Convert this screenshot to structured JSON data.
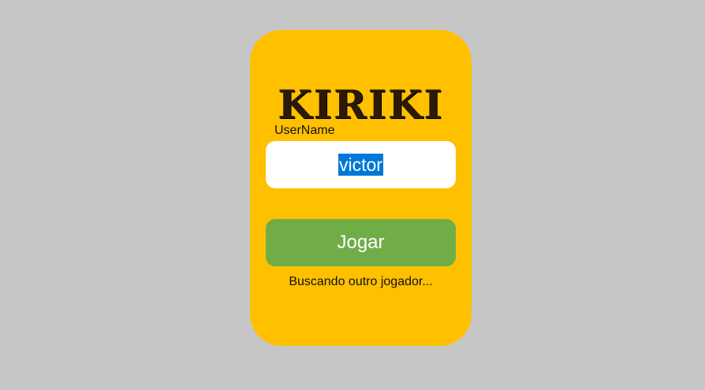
{
  "app": {
    "title": "KIRIKI"
  },
  "login": {
    "username_label": "UserName",
    "username_value": "victor",
    "play_label": "Jogar",
    "status": "Buscando outro jogador..."
  },
  "colors": {
    "background": "#c6c6c6",
    "card": "#ffc000",
    "input": "#ffffff",
    "selection": "#0078d7",
    "play_button": "#70ad47"
  }
}
